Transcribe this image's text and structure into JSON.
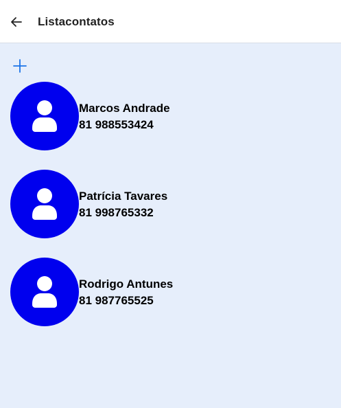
{
  "header": {
    "title": "Listacontatos",
    "back_icon": "arrow-left-icon"
  },
  "toolbar": {
    "add_icon": "plus-icon",
    "accent_color": "#1a73e8"
  },
  "contacts": [
    {
      "name": "Marcos Andrade",
      "phone": "81 988553424",
      "avatar_icon": "person-icon"
    },
    {
      "name": "Patrícia Tavares",
      "phone": "81 998765332",
      "avatar_icon": "person-icon"
    },
    {
      "name": "Rodrigo Antunes",
      "phone": "81 987765525",
      "avatar_icon": "person-icon"
    }
  ],
  "colors": {
    "background": "#e6eefb",
    "avatar": "#0000ee",
    "header": "#ffffff"
  }
}
